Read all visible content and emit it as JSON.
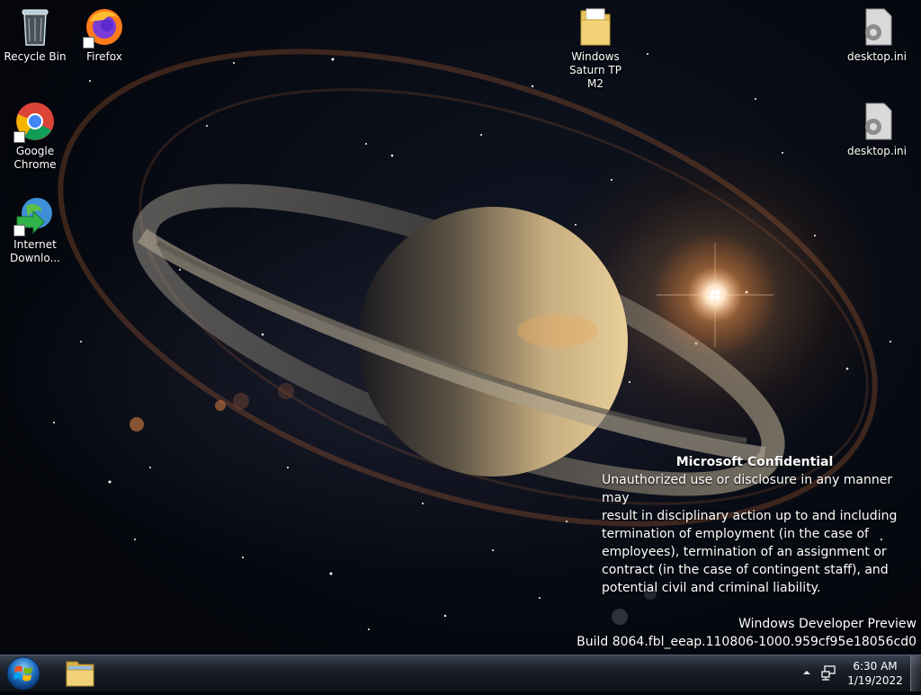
{
  "desktop_icons": {
    "recycle_bin": "Recycle Bin",
    "firefox": "Firefox",
    "google_chrome_line1": "Google",
    "google_chrome_line2": "Chrome",
    "idm_line1": "Internet",
    "idm_line2": "Downlo...",
    "folder_line1": "Windows",
    "folder_line2": "Saturn TP M2",
    "desktop_ini_1": "desktop.ini",
    "desktop_ini_2": "desktop.ini"
  },
  "confidential": {
    "title": "Microsoft Confidential",
    "lines": [
      "Unauthorized use or disclosure in any manner may",
      "result in disciplinary action up to and including",
      "termination of employment (in the case of",
      "employees), termination of an assignment or",
      "contract (in the case of contingent staff), and",
      "potential civil and criminal liability."
    ]
  },
  "watermark": {
    "line1": "Windows Developer Preview",
    "line2": "Build 8064.fbl_eeap.110806-1000.959cf95e18056cd0"
  },
  "taskbar": {
    "time": "6:30 AM",
    "date": "1/19/2022"
  },
  "icons": {
    "start": "windows-orb-icon",
    "explorer": "folder-icon",
    "tray_arrow": "chevron-up-icon",
    "network": "network-icon"
  }
}
